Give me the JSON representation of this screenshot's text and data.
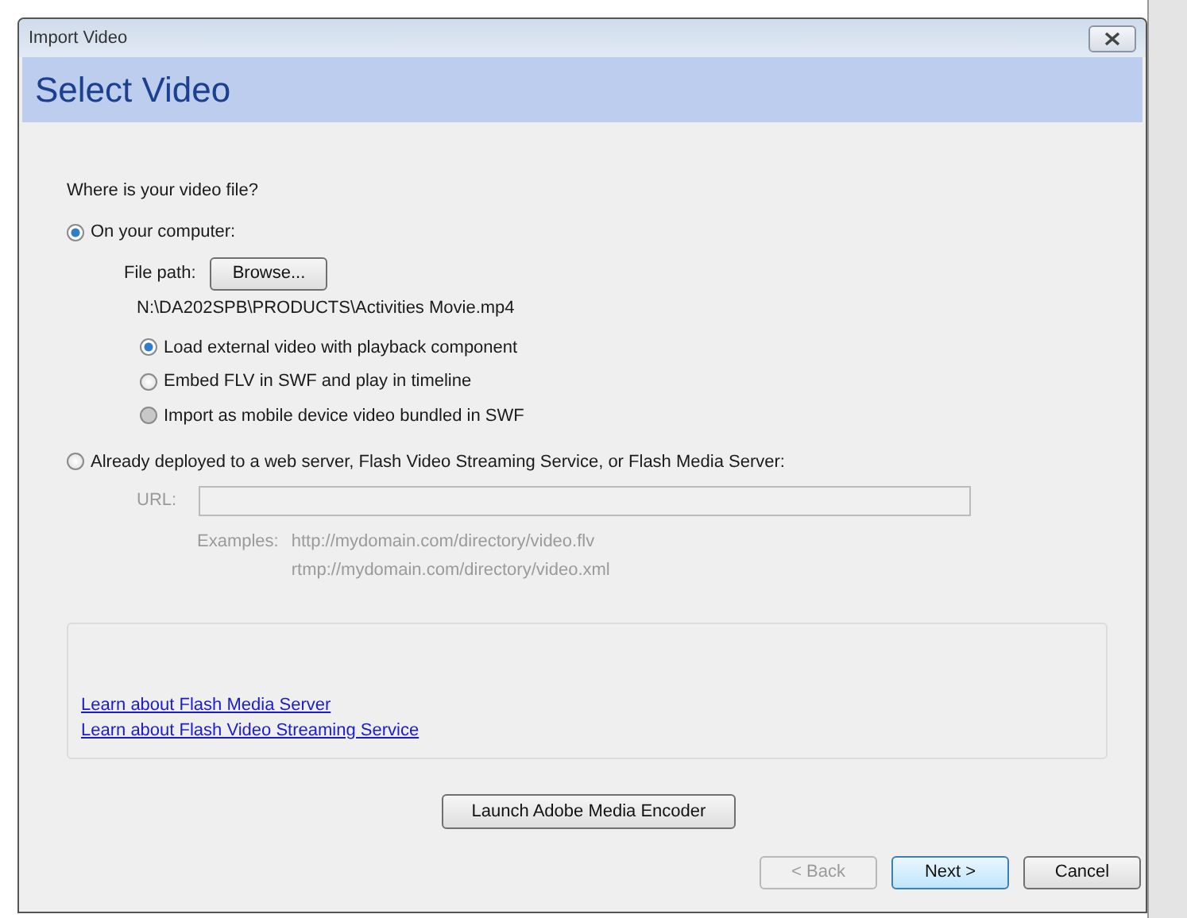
{
  "window": {
    "title": "Import Video"
  },
  "header": "Select Video",
  "question": "Where is your video file?",
  "sources": [
    {
      "label": "On your computer:",
      "selected": true
    },
    {
      "label": "Already deployed to a web server, Flash Video Streaming Service, or Flash Media Server:",
      "selected": false
    }
  ],
  "file_path": {
    "label": "File path:",
    "button": "Browse...",
    "value": "N:\\DA202SPB\\PRODUCTS\\Activities Movie.mp4"
  },
  "options": [
    {
      "label": "Load external video with playback component",
      "selected": true,
      "disabled": false
    },
    {
      "label": "Embed FLV in SWF and play in timeline",
      "selected": false,
      "disabled": false
    },
    {
      "label": "Import as mobile device video bundled in SWF",
      "selected": false,
      "disabled": true
    }
  ],
  "url": {
    "label": "URL:",
    "disabled": true,
    "examples_label": "Examples:",
    "examples": [
      "http://mydomain.com/directory/video.flv",
      "rtmp://mydomain.com/directory/video.xml"
    ]
  },
  "links": [
    "Learn about Flash Media Server",
    "Learn about Flash Video Streaming Service"
  ],
  "encoder_button": "Launch Adobe Media Encoder",
  "buttons": [
    {
      "label": "< Back",
      "disabled": true,
      "default": false
    },
    {
      "label": "Next >",
      "disabled": false,
      "default": true
    },
    {
      "label": "Cancel",
      "disabled": false,
      "default": false
    }
  ]
}
